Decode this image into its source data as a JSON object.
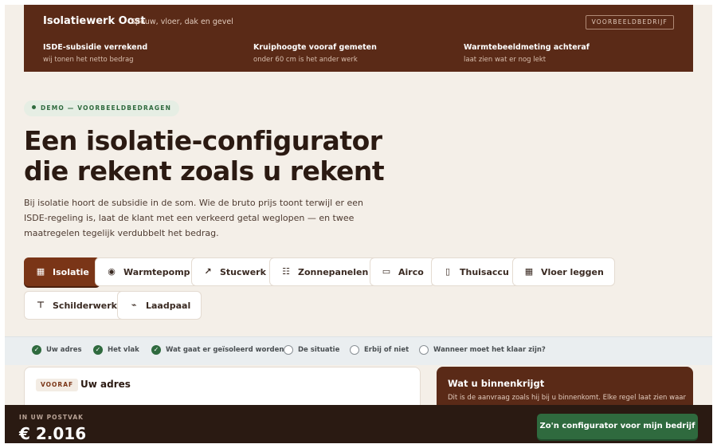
{
  "banner": {
    "brand": "Isolatiewerk Oost",
    "tagline": "Spouw, vloer, dak en gevel",
    "demo_chip": "VOORBEELDBEDRIJF",
    "features": [
      {
        "title": "ISDE-subsidie verrekend",
        "subtitle": "wij tonen het netto bedrag"
      },
      {
        "title": "Kruiphoogte vooraf gemeten",
        "subtitle": "onder 60 cm is het ander werk"
      },
      {
        "title": "Warmtebeeldmeting achteraf",
        "subtitle": "laat zien wat er nog lekt"
      }
    ]
  },
  "hero": {
    "pill": "DEMO — VOORBEELDBEDRAGEN",
    "title_line1": "Een isolatie-configurator",
    "title_line2": "die rekent zoals u rekent",
    "body": "Bij isolatie hoort de subsidie in de som. Wie de bruto prijs toont terwijl er een ISDE-regeling is, laat de klant met een verkeerd getal weglopen — en twee maatregelen tegelijk verdubbelt het bedrag."
  },
  "tabs": [
    {
      "label": "Isolatie",
      "icon": "grid-icon",
      "glyph": "▦",
      "active": true
    },
    {
      "label": "Warmtepomp",
      "icon": "heatpump-icon",
      "glyph": "◉",
      "active": false
    },
    {
      "label": "Stucwerk",
      "icon": "trowel-icon",
      "glyph": "↗",
      "active": false
    },
    {
      "label": "Zonnepanelen",
      "icon": "solar-panel-icon",
      "glyph": "☷",
      "active": false
    },
    {
      "label": "Airco",
      "icon": "airco-icon",
      "glyph": "▭",
      "active": false
    },
    {
      "label": "Thuisaccu",
      "icon": "battery-icon",
      "glyph": "▯",
      "active": false
    },
    {
      "label": "Vloer leggen",
      "icon": "floor-grid-icon",
      "glyph": "▦",
      "active": false
    },
    {
      "label": "Schilderwerk",
      "icon": "paint-roller-icon",
      "glyph": "⊤",
      "active": false
    },
    {
      "label": "Laadpaal",
      "icon": "charger-icon",
      "glyph": "⌁",
      "active": false
    }
  ],
  "steps": [
    {
      "label": "Uw adres",
      "done": true
    },
    {
      "label": "Het vlak",
      "done": true
    },
    {
      "label": "Wat gaat er geïsoleerd worden",
      "done": true
    },
    {
      "label": "De situatie",
      "done": false
    },
    {
      "label": "Erbij of niet",
      "done": false
    },
    {
      "label": "Wanneer moet het klaar zijn?",
      "done": false
    }
  ],
  "address_card": {
    "chip": "VOORAF",
    "title": "Uw adres"
  },
  "summary_card": {
    "title": "Wat u binnenkrijgt",
    "body": "Dit is de aanvraag zoals hij bij u binnenkomt. Elke regel laat zien waar"
  },
  "bottom_bar": {
    "label": "IN UW POSTVAK",
    "total": "€ 2.016",
    "cta": "Zo'n configurator voor mijn bedrijf"
  },
  "colors": {
    "brand_dark": "#5a2a17",
    "active_tab": "#7a3517",
    "green": "#2f6a3e",
    "background": "#f4efe8",
    "bottom_bar": "#2a1a12"
  }
}
